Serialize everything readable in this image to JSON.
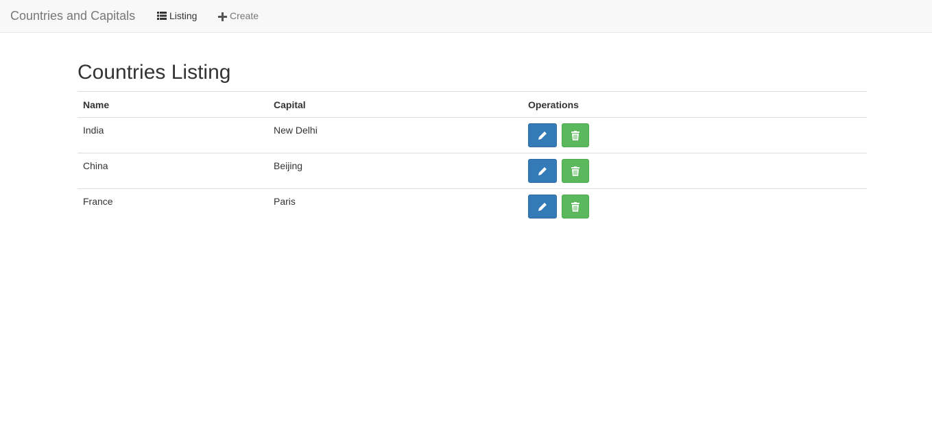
{
  "navbar": {
    "brand": "Countries and Capitals",
    "links": [
      {
        "label": "Listing",
        "icon": "list-icon"
      },
      {
        "label": "Create",
        "icon": "plus-icon"
      }
    ]
  },
  "page": {
    "title": "Countries Listing"
  },
  "table": {
    "columns": [
      "Name",
      "Capital",
      "Operations"
    ],
    "rows": [
      {
        "name": "India",
        "capital": "New Delhi"
      },
      {
        "name": "China",
        "capital": "Beijing"
      },
      {
        "name": "France",
        "capital": "Paris"
      }
    ],
    "operations": [
      {
        "icon": "pencil-icon",
        "color": "#337ab7"
      },
      {
        "icon": "trash-icon",
        "color": "#5cb85c"
      }
    ]
  }
}
